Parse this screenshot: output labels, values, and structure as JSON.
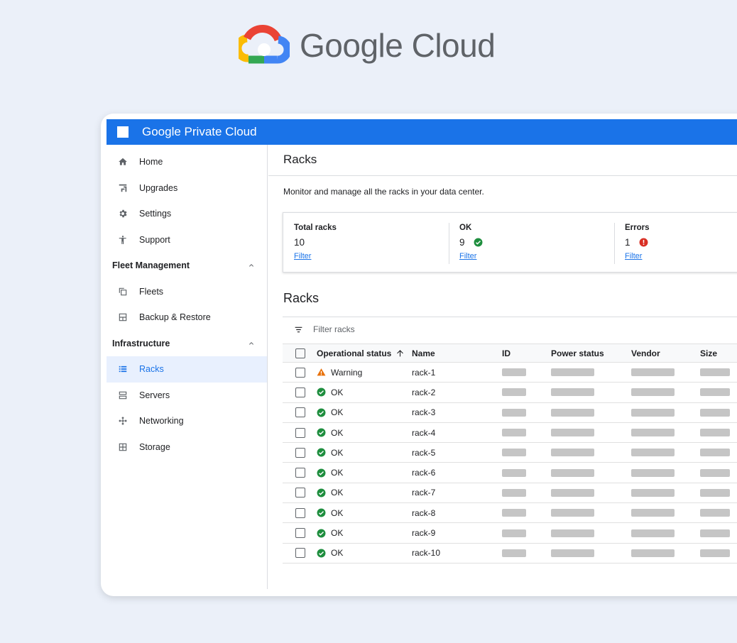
{
  "brand": {
    "name": "Google Cloud"
  },
  "app": {
    "title": "Google Private Cloud"
  },
  "sidebar": {
    "top_items": [
      {
        "label": "Home",
        "icon": "home-icon"
      },
      {
        "label": "Upgrades",
        "icon": "upgrades-icon"
      },
      {
        "label": "Settings",
        "icon": "gear-icon"
      },
      {
        "label": "Support",
        "icon": "support-icon"
      }
    ],
    "sections": [
      {
        "label": "Fleet Management",
        "items": [
          {
            "label": "Fleets",
            "icon": "fleets-icon"
          },
          {
            "label": "Backup & Restore",
            "icon": "backup-icon"
          }
        ]
      },
      {
        "label": "Infrastructure",
        "items": [
          {
            "label": "Racks",
            "icon": "list-icon",
            "active": true
          },
          {
            "label": "Servers",
            "icon": "servers-icon"
          },
          {
            "label": "Networking",
            "icon": "networking-icon"
          },
          {
            "label": "Storage",
            "icon": "storage-icon"
          }
        ]
      }
    ]
  },
  "page": {
    "title": "Racks",
    "description": "Monitor and manage all the racks in your data center.",
    "section_title": "Racks",
    "filter_placeholder": "Filter racks"
  },
  "summary": [
    {
      "label": "Total racks",
      "value": "10",
      "link": "Filter",
      "icon": ""
    },
    {
      "label": "OK",
      "value": "9",
      "link": "Filter",
      "icon": "check-circle-icon"
    },
    {
      "label": "Errors",
      "value": "1",
      "link": "Filter",
      "icon": "error-icon"
    }
  ],
  "table": {
    "columns": [
      "Operational status",
      "Name",
      "ID",
      "Power status",
      "Vendor",
      "Size"
    ],
    "rows": [
      {
        "status": "Warning",
        "name": "rack-1"
      },
      {
        "status": "OK",
        "name": "rack-2"
      },
      {
        "status": "OK",
        "name": "rack-3"
      },
      {
        "status": "OK",
        "name": "rack-4"
      },
      {
        "status": "OK",
        "name": "rack-5"
      },
      {
        "status": "OK",
        "name": "rack-6"
      },
      {
        "status": "OK",
        "name": "rack-7"
      },
      {
        "status": "OK",
        "name": "rack-8"
      },
      {
        "status": "OK",
        "name": "rack-9"
      },
      {
        "status": "OK",
        "name": "rack-10"
      }
    ]
  },
  "colors": {
    "primary": "#1a73e8",
    "ok": "#1e8e3e",
    "warning": "#e8710a",
    "error": "#d93025"
  }
}
